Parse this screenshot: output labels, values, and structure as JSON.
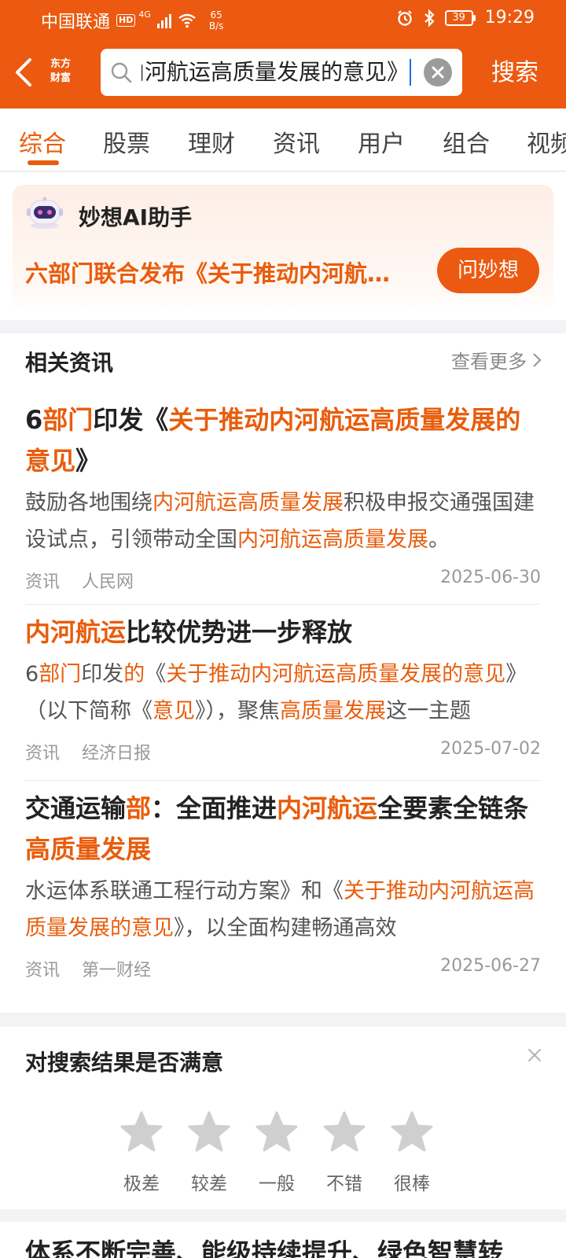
{
  "status_bar": {
    "carrier": "中国联通",
    "hd": "HD",
    "network": "4G",
    "speed_value": "65",
    "speed_unit": "B/s",
    "battery": "39",
    "time": "19:29"
  },
  "header": {
    "logo_line1": "东方",
    "logo_line2": "财富",
    "search_value": "关于推动内河航运高质量发展的意见》",
    "search_button": "搜索"
  },
  "tabs": [
    "综合",
    "股票",
    "理财",
    "资讯",
    "用户",
    "组合",
    "视频"
  ],
  "ai_card": {
    "title": "妙想AI助手",
    "question": "六部门联合发布《关于推动内河航运高质量发展的意见》",
    "button": "问妙想"
  },
  "news": {
    "header": "相关资讯",
    "more": "查看更多",
    "items": [
      {
        "title_parts": [
          {
            "t": "6",
            "h": false
          },
          {
            "t": "部门",
            "h": true
          },
          {
            "t": "印发《",
            "h": false
          },
          {
            "t": "关于推动内河航运高质量发展的意见",
            "h": true
          },
          {
            "t": "》",
            "h": false
          }
        ],
        "summary_parts": [
          {
            "t": "鼓励各地围绕",
            "h": false
          },
          {
            "t": "内河航运高质量发展",
            "h": true
          },
          {
            "t": "积极申报交通强国建设试点，引领带动全国",
            "h": false
          },
          {
            "t": "内河航运高质量发展",
            "h": true
          },
          {
            "t": "。",
            "h": false
          }
        ],
        "category": "资讯",
        "source": "人民网",
        "date": "2025-06-30"
      },
      {
        "title_parts": [
          {
            "t": "内河航运",
            "h": true
          },
          {
            "t": "比较优势进一步释放",
            "h": false
          }
        ],
        "summary_parts": [
          {
            "t": "6",
            "h": false
          },
          {
            "t": "部门",
            "h": true
          },
          {
            "t": "印发",
            "h": false
          },
          {
            "t": "的",
            "h": true
          },
          {
            "t": "《",
            "h": false
          },
          {
            "t": "关于推动内河航运高质量发展的意见",
            "h": true
          },
          {
            "t": "》（以下简称《",
            "h": false
          },
          {
            "t": "意见",
            "h": true
          },
          {
            "t": "》），聚焦",
            "h": false
          },
          {
            "t": "高质量发展",
            "h": true
          },
          {
            "t": "这一主题",
            "h": false
          }
        ],
        "category": "资讯",
        "source": "经济日报",
        "date": "2025-07-02"
      },
      {
        "title_parts": [
          {
            "t": "交通运输",
            "h": false
          },
          {
            "t": "部",
            "h": true
          },
          {
            "t": "：全面推进",
            "h": false
          },
          {
            "t": "内河航运",
            "h": true
          },
          {
            "t": "全要素全链条",
            "h": false
          },
          {
            "t": "高质量发展",
            "h": true
          }
        ],
        "summary_parts": [
          {
            "t": "水运体系联通工程行动方案》和《",
            "h": false
          },
          {
            "t": "关于推动内河航运高质量发展的意见",
            "h": true
          },
          {
            "t": "》，以全面构建畅通高效",
            "h": false
          }
        ],
        "category": "资讯",
        "source": "第一财经",
        "date": "2025-06-27"
      }
    ]
  },
  "feedback": {
    "title": "对搜索结果是否满意",
    "ratings": [
      "极差",
      "较差",
      "一般",
      "不错",
      "很棒"
    ]
  },
  "next_item": {
    "title": "体系不断完善、能级持续提升、绿色智慧转"
  },
  "colors": {
    "brand": "#eb5a10",
    "highlight": "#e85d0c"
  }
}
